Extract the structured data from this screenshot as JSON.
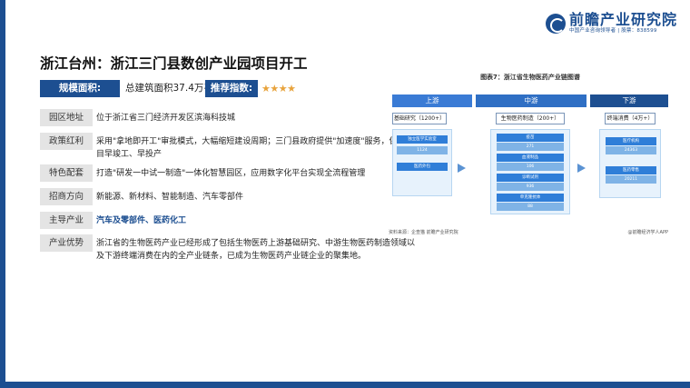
{
  "logo": {
    "name": "前瞻产业研究院",
    "tagline": "中国产业咨询领导者 | 股票：838599"
  },
  "title": "浙江台州：浙江三门县数创产业园项目开工",
  "scale": {
    "label": "规模面积:",
    "value": "总建筑面积37.4万平方米",
    "rating_label": "推荐指数:",
    "rating_stars": "★★★★",
    "rating_value": 4
  },
  "rows": [
    {
      "label": "园区地址",
      "value": "位于浙江省三门经济开发区滨海科技城"
    },
    {
      "label": "政策红利",
      "value": "采用\"拿地即开工\"审批模式，大幅缩短建设周期；三门县政府提供\"加速度\"服务，保障项目早竣工、早投产"
    },
    {
      "label": "特色配套",
      "value": "打造\"研发一中试一制造\"一体化智慧园区，应用数字化平台实现全流程管理"
    },
    {
      "label": "招商方向",
      "value": "新能源、新材料、智能制造、汽车零部件"
    },
    {
      "label": "主导产业",
      "value": "汽车及零部件、医药化工"
    },
    {
      "label": "产业优势",
      "value": "浙江省的生物医药产业已经形成了包括生物医药上游基础研究、中游生物医药制造领域以及下游终端消费在内的全产业链条，已成为生物医药产业链企业的聚集地。"
    }
  ],
  "figure": {
    "title": "图表7：浙江省生物医药产业链图谱",
    "stages": [
      "上游",
      "中游",
      "下游"
    ],
    "upstream": {
      "header": "基础研究（1200+）",
      "items": [
        {
          "name": "独立医学实验室",
          "value": "1124"
        },
        {
          "name": "医药外包",
          "value": ""
        }
      ]
    },
    "midstream": {
      "header": "生物医药制造（200+）",
      "items": [
        {
          "name": "疫苗",
          "value": "271"
        },
        {
          "name": "血液制品",
          "value": "106"
        },
        {
          "name": "诊断试剂",
          "value": "936"
        },
        {
          "name": "单克隆抗体",
          "value": "88"
        }
      ]
    },
    "downstream": {
      "header": "终端消费（4万+）",
      "items": [
        {
          "name": "医疗机构",
          "value": "24363"
        },
        {
          "name": "医药零售",
          "value": "20211"
        }
      ]
    },
    "source": "资料来源：企查猫 前瞻产业研究院",
    "brand": "@前瞻经济学人APP"
  },
  "colors": {
    "primary": "#1d4f91",
    "star": "#e8a33c",
    "label_bg": "#e4e4e4"
  }
}
